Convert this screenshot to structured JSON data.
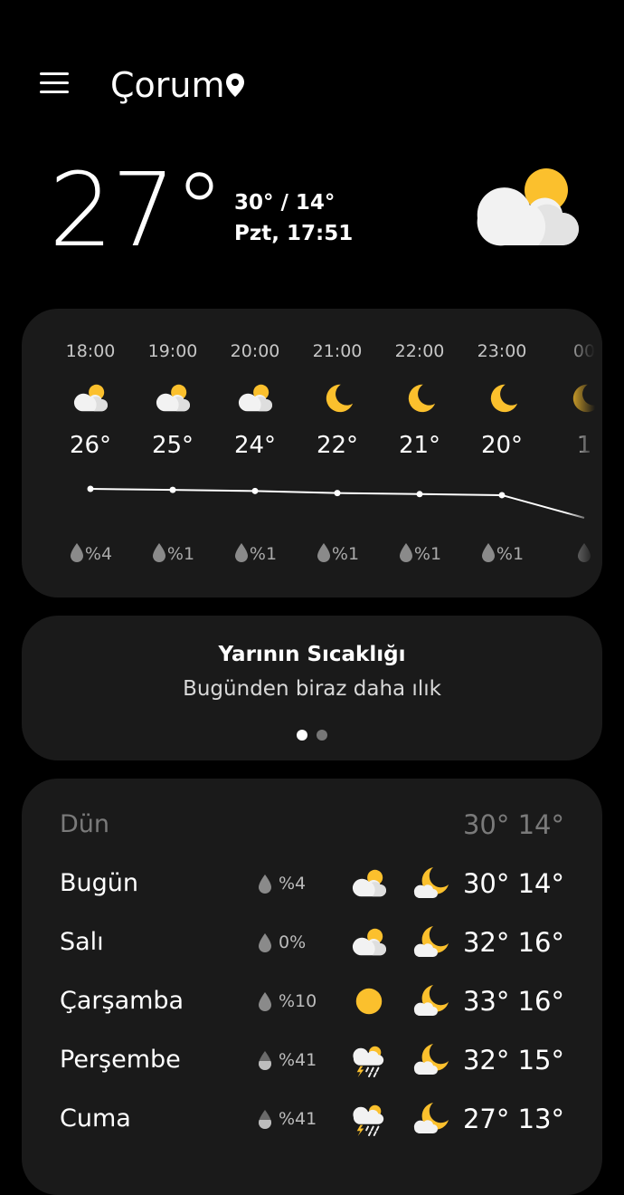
{
  "header": {
    "city": "Çorum",
    "menu_icon": "hamburger-menu-icon",
    "location_icon": "location-pin-icon"
  },
  "current": {
    "temperature": "27°",
    "high_low": "30° / 14°",
    "day_time": "Pzt, 17:51",
    "icon": "partly-cloudy-day-icon"
  },
  "hourly": [
    {
      "time": "18:00",
      "icon": "partly-cloudy-day-icon",
      "temp": "26°",
      "precip": "%4"
    },
    {
      "time": "19:00",
      "icon": "partly-cloudy-day-icon",
      "temp": "25°",
      "precip": "%1"
    },
    {
      "time": "20:00",
      "icon": "partly-cloudy-day-icon",
      "temp": "24°",
      "precip": "%1"
    },
    {
      "time": "21:00",
      "icon": "moon-icon",
      "temp": "22°",
      "precip": "%1"
    },
    {
      "time": "22:00",
      "icon": "moon-icon",
      "temp": "21°",
      "precip": "%1"
    },
    {
      "time": "23:00",
      "icon": "moon-icon",
      "temp": "20°",
      "precip": "%1"
    },
    {
      "time": "00",
      "icon": "moon-icon",
      "temp": "1",
      "precip": ""
    }
  ],
  "tomorrow": {
    "title": "Yarının Sıcaklığı",
    "subtitle": "Bugünden biraz daha ılık",
    "page_index": 1,
    "page_count": 2
  },
  "daily": {
    "yesterday": {
      "label": "Dün",
      "temps": "30° 14°"
    },
    "days": [
      {
        "name": "Bugün",
        "precip": "%4",
        "drop": "empty",
        "day_icon": "partly-cloudy-day-icon",
        "night_icon": "partly-cloudy-night-icon",
        "temps": "30° 14°"
      },
      {
        "name": "Salı",
        "precip": "0%",
        "drop": "empty",
        "day_icon": "partly-cloudy-day-icon",
        "night_icon": "partly-cloudy-night-icon",
        "temps": "32° 16°"
      },
      {
        "name": "Çarşamba",
        "precip": "%10",
        "drop": "empty",
        "day_icon": "sun-icon",
        "night_icon": "partly-cloudy-night-icon",
        "temps": "33° 16°"
      },
      {
        "name": "Perşembe",
        "precip": "%41",
        "drop": "half",
        "day_icon": "thunderstorm-icon",
        "night_icon": "partly-cloudy-night-icon",
        "temps": "32° 15°"
      },
      {
        "name": "Cuma",
        "precip": "%41",
        "drop": "half",
        "day_icon": "thunderstorm-icon",
        "night_icon": "partly-cloudy-night-icon",
        "temps": "27° 13°"
      }
    ]
  },
  "colors": {
    "background": "#000000",
    "card": "#1a1a1a",
    "sun": "#fbc02d",
    "cloud": "#f2f2f2"
  }
}
